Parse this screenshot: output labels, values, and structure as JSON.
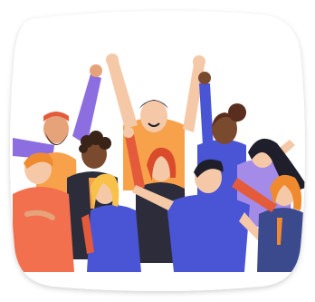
{
  "illustration": {
    "subject": "crowd-of-cheering-people-icon",
    "colors": {
      "frame_fill": "#ffffff",
      "frame_shadow": "#d9d9d9",
      "skin_light": "#f5c9a8",
      "skin_tan": "#e6a37a",
      "skin_dark": "#7a4a2e",
      "hair_dark": "#1f1f2b",
      "hair_brown": "#5a2e1e",
      "hair_red": "#d94b2b",
      "hair_ginger": "#f08a2e",
      "shirt_orange": "#f7a24a",
      "shirt_purple": "#8d6ee0",
      "shirt_blue": "#4a55d6",
      "shirt_coral": "#f2704e",
      "shirt_red": "#e45b3b",
      "shirt_lavender": "#a58be8",
      "shirt_dark": "#2c2c3a",
      "shirt_navy": "#3b4a8c"
    }
  }
}
